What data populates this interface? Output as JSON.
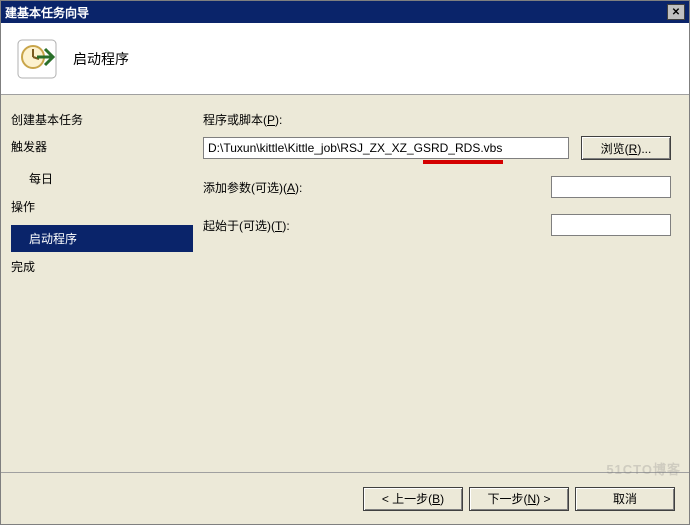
{
  "window": {
    "title_fragment": "建基本任务向导"
  },
  "header": {
    "page_title": "启动程序"
  },
  "sidebar": {
    "create_basic_task": "创建基本任务",
    "trigger": "触发器",
    "daily": "每日",
    "action": "操作",
    "start_program": "启动程序",
    "finish": "完成"
  },
  "form": {
    "program_label_pre": "程序或脚本",
    "program_label_ak": "P",
    "program_value": "D:\\Tuxun\\kittle\\Kittle_job\\RSJ_ZX_XZ_GSRD_RDS.vbs",
    "browse_btn_pre": "浏览",
    "browse_btn_ak": "R",
    "browse_btn_suffix": "...",
    "args_label_pre": "添加参数(可选)",
    "args_label_ak": "A",
    "args_value": "",
    "startin_label_pre": "起始于(可选)",
    "startin_label_ak": "T",
    "startin_value": ""
  },
  "footer": {
    "back_pre": "< 上一步",
    "back_ak": "B",
    "next_pre": "下一步",
    "next_ak": "N",
    "next_post": " >",
    "cancel": "取消"
  },
  "watermark": "51CTO博客"
}
